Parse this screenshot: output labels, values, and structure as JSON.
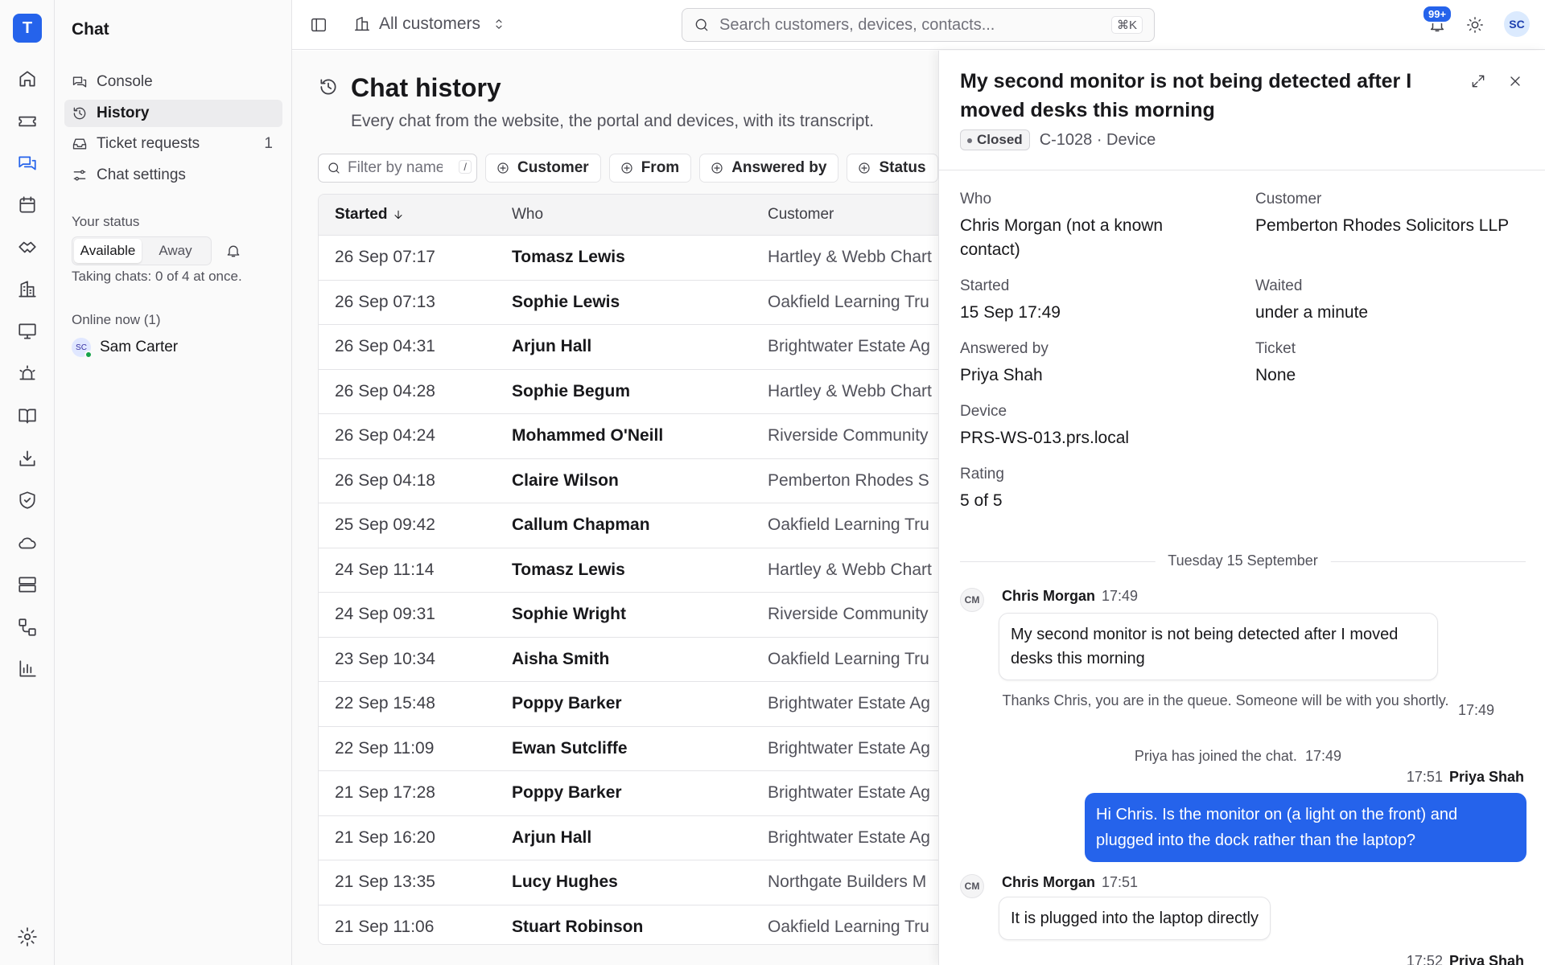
{
  "app": {
    "logo_letter": "T",
    "brand_color": "#2563eb"
  },
  "rail": {
    "items": [
      "home-icon",
      "ticket-icon",
      "chat-icon",
      "calendar-icon",
      "handshake-icon",
      "building-icon",
      "monitor-icon",
      "alarm-icon",
      "book-icon",
      "download-icon",
      "shield-icon",
      "cloud-icon",
      "server-icon",
      "workflow-icon",
      "chart-icon",
      "gear-icon"
    ],
    "active": "chat-icon"
  },
  "sidebar": {
    "title": "Chat",
    "items": [
      {
        "label": "Console"
      },
      {
        "label": "History"
      },
      {
        "label": "Ticket requests",
        "count": "1"
      },
      {
        "label": "Chat settings"
      }
    ],
    "status": {
      "label": "Your status",
      "available": "Available",
      "away": "Away",
      "selected": "Available",
      "taking": "Taking chats: 0 of 4 at once."
    },
    "online": {
      "label": "Online now (1)",
      "user_initials": "SC",
      "user_name": "Sam Carter"
    }
  },
  "topbar": {
    "scope": "All customers",
    "search_placeholder": "Search customers, devices, contacts...",
    "search_shortcut": "⌘K",
    "notif_badge": "99+",
    "avatar": "SC"
  },
  "main": {
    "title": "Chat history",
    "subtitle": "Every chat from the website, the portal and devices, with its transcript.",
    "filter_placeholder": "Filter by name",
    "filter_shortcut": "/",
    "chips": [
      "Customer",
      "From",
      "Answered by",
      "Status"
    ],
    "columns": [
      "Started",
      "Who",
      "Customer"
    ],
    "rows": [
      {
        "started": "26 Sep 07:17",
        "who": "Tomasz Lewis",
        "customer": "Hartley & Webb Chart"
      },
      {
        "started": "26 Sep 07:13",
        "who": "Sophie Lewis",
        "customer": "Oakfield Learning Tru"
      },
      {
        "started": "26 Sep 04:31",
        "who": "Arjun Hall",
        "customer": "Brightwater Estate Ag"
      },
      {
        "started": "26 Sep 04:28",
        "who": "Sophie Begum",
        "customer": "Hartley & Webb Chart"
      },
      {
        "started": "26 Sep 04:24",
        "who": "Mohammed O'Neill",
        "customer": "Riverside Community"
      },
      {
        "started": "26 Sep 04:18",
        "who": "Claire Wilson",
        "customer": "Pemberton Rhodes S"
      },
      {
        "started": "25 Sep 09:42",
        "who": "Callum Chapman",
        "customer": "Oakfield Learning Tru"
      },
      {
        "started": "24 Sep 11:14",
        "who": "Tomasz Lewis",
        "customer": "Hartley & Webb Chart"
      },
      {
        "started": "24 Sep 09:31",
        "who": "Sophie Wright",
        "customer": "Riverside Community"
      },
      {
        "started": "23 Sep 10:34",
        "who": "Aisha Smith",
        "customer": "Oakfield Learning Tru"
      },
      {
        "started": "22 Sep 15:48",
        "who": "Poppy Barker",
        "customer": "Brightwater Estate Ag"
      },
      {
        "started": "22 Sep 11:09",
        "who": "Ewan Sutcliffe",
        "customer": "Brightwater Estate Ag"
      },
      {
        "started": "21 Sep 17:28",
        "who": "Poppy Barker",
        "customer": "Brightwater Estate Ag"
      },
      {
        "started": "21 Sep 16:20",
        "who": "Arjun Hall",
        "customer": "Brightwater Estate Ag"
      },
      {
        "started": "21 Sep 13:35",
        "who": "Lucy Hughes",
        "customer": "Northgate Builders M"
      },
      {
        "started": "21 Sep 11:06",
        "who": "Stuart Robinson",
        "customer": "Oakfield Learning Tru"
      }
    ]
  },
  "detail": {
    "title": "My second monitor is not being detected after I moved desks this morning",
    "status": "Closed",
    "ref": "C-1028 · Device",
    "fields": {
      "who_label": "Who",
      "who": "Chris Morgan (not a known contact)",
      "customer_label": "Customer",
      "customer": "Pemberton Rhodes Solicitors LLP",
      "started_label": "Started",
      "started": "15 Sep 17:49",
      "waited_label": "Waited",
      "waited": "under a minute",
      "answered_label": "Answered by",
      "answered": "Priya Shah",
      "ticket_label": "Ticket",
      "ticket": "None",
      "device_label": "Device",
      "device": "PRS-WS-013.prs.local",
      "rating_label": "Rating",
      "rating": "5 of 5"
    },
    "transcript": {
      "date": "Tuesday 15 September",
      "m1": {
        "initials": "CM",
        "name": "Chris Morgan",
        "time": "17:49",
        "text": "My second monitor is not being detected after I moved desks this morning"
      },
      "sys1": {
        "text": "Thanks Chris, you are in the queue. Someone will be with you shortly.",
        "time": "17:49"
      },
      "sys2": {
        "text": "Priya has joined the chat.",
        "time": "17:49"
      },
      "m2": {
        "name": "Priya Shah",
        "time": "17:51",
        "text": "Hi Chris. Is the monitor on (a light on the front) and plugged into the dock rather than the laptop?"
      },
      "m3": {
        "initials": "CM",
        "name": "Chris Morgan",
        "time": "17:51",
        "text": "It is plugged into the laptop directly"
      },
      "m4": {
        "name": "Priya Shah",
        "time": "17:52"
      }
    }
  }
}
